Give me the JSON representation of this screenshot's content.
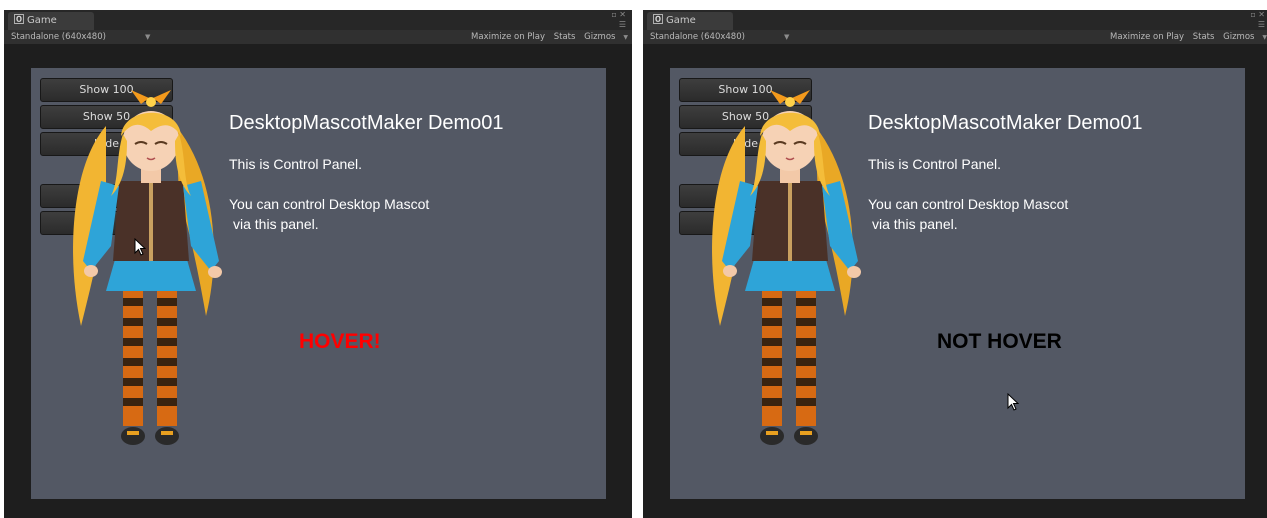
{
  "panels": [
    {
      "tab_label": "Game",
      "tab_icon": "unity-logo-icon",
      "resolution": "Standalone (640x480)",
      "maximize_label": "Maximize on Play",
      "stats_label": "Stats",
      "gizmos_label": "Gizmos",
      "buttons": [
        {
          "label": "Show 100"
        },
        {
          "label": "Show 50"
        },
        {
          "label": "Hide"
        },
        {
          "label": ""
        },
        {
          "label": ""
        }
      ],
      "heading": "DesktopMascotMaker Demo01",
      "line1": "This is Control Panel.",
      "line2": "You can control Desktop Mascot",
      "line3": "via this panel.",
      "status": "HOVER!",
      "status_color": "#ff0000"
    },
    {
      "tab_label": "Game",
      "tab_icon": "unity-logo-icon",
      "resolution": "Standalone (640x480)",
      "maximize_label": "Maximize on Play",
      "stats_label": "Stats",
      "gizmos_label": "Gizmos",
      "buttons": [
        {
          "label": "Show 100"
        },
        {
          "label": "Show 50"
        },
        {
          "label": "Hide"
        },
        {
          "label": ""
        },
        {
          "label": ""
        }
      ],
      "heading": "DesktopMascotMaker Demo01",
      "line1": "This is Control Panel.",
      "line2": "You can control Desktop Mascot",
      "line3": "via this panel.",
      "status": "NOT HOVER",
      "status_color": "#000000"
    }
  ],
  "colors": {
    "editor_bg": "#1e1e1e",
    "viewport_bg": "#535864",
    "text": "#ffffff"
  }
}
